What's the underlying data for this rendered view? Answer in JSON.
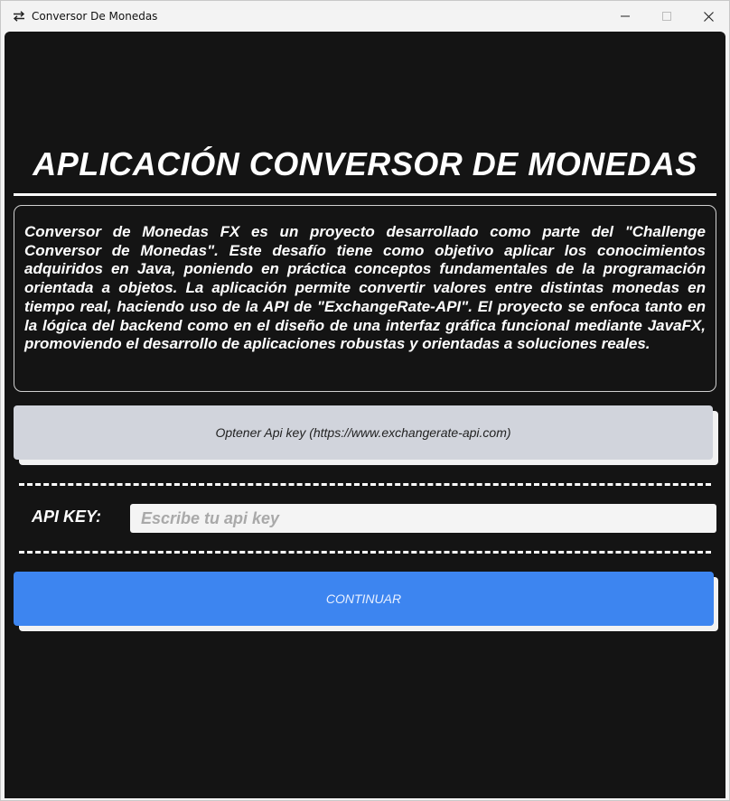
{
  "window": {
    "title": "Conversor De Monedas",
    "icon": "swap-arrows-icon",
    "controls": [
      "minimize-icon",
      "maximize-icon",
      "close-icon"
    ]
  },
  "main": {
    "heading": "APLICACIÓN CONVERSOR DE MONEDAS",
    "description": "Conversor de Monedas FX es un proyecto desarrollado como parte del \"Challenge Conversor de Monedas\". Este desafío tiene como objetivo aplicar los conocimientos adquiridos en Java, poniendo en práctica conceptos fundamentales de la programación orientada a objetos. La aplicación permite convertir valores entre distintas monedas en tiempo real, haciendo uso de la API de \"ExchangeRate-API\". El proyecto se enfoca tanto en la lógica del backend como en el diseño de una interfaz gráfica funcional mediante JavaFX, promoviendo el desarrollo de aplicaciones robustas y orientadas a soluciones reales.",
    "api_link_button": "Optener Api key (https://www.exchangerate-api.com)",
    "api_key_label": "API KEY:",
    "api_key_input": {
      "value": "",
      "placeholder": "Escribe tu api key"
    },
    "continue_button": "CONTINUAR"
  },
  "colors": {
    "background": "#141414",
    "accent": "#3d85f0",
    "secondary_button": "#d1d4dc",
    "text": "#ffffff"
  }
}
